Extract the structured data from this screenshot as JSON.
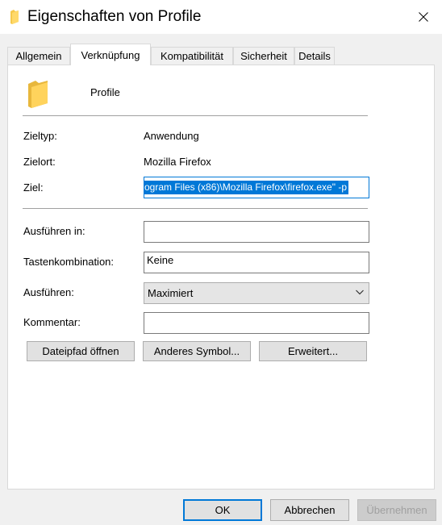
{
  "window": {
    "title": "Eigenschaften von Profile",
    "close_icon": "close-icon"
  },
  "tabs": [
    {
      "label": "Allgemein"
    },
    {
      "label": "Verknüpfung"
    },
    {
      "label": "Kompatibilität"
    },
    {
      "label": "Sicherheit"
    },
    {
      "label": "Details"
    }
  ],
  "active_tab": "Verknüpfung",
  "shortcut": {
    "name": "Profile",
    "target_type_label": "Zieltyp:",
    "target_type_value": "Anwendung",
    "target_location_label": "Zielort:",
    "target_location_value": "Mozilla Firefox",
    "target_label": "Ziel:",
    "target_value": "ogram Files (x86)\\Mozilla Firefox\\firefox.exe\" -p",
    "start_in_label": "Ausführen in:",
    "start_in_value": "",
    "hotkey_label": "Tastenkombination:",
    "hotkey_value": "Keine",
    "run_label": "Ausführen:",
    "run_value": "Maximiert",
    "comment_label": "Kommentar:",
    "comment_value": ""
  },
  "buttons": {
    "open_file_location": "Dateipfad öffnen",
    "change_icon": "Anderes Symbol...",
    "advanced": "Erweitert..."
  },
  "footer": {
    "ok": "OK",
    "cancel": "Abbrechen",
    "apply": "Übernehmen"
  },
  "colors": {
    "accent": "#0078d7",
    "folder": "#ffd35c"
  }
}
